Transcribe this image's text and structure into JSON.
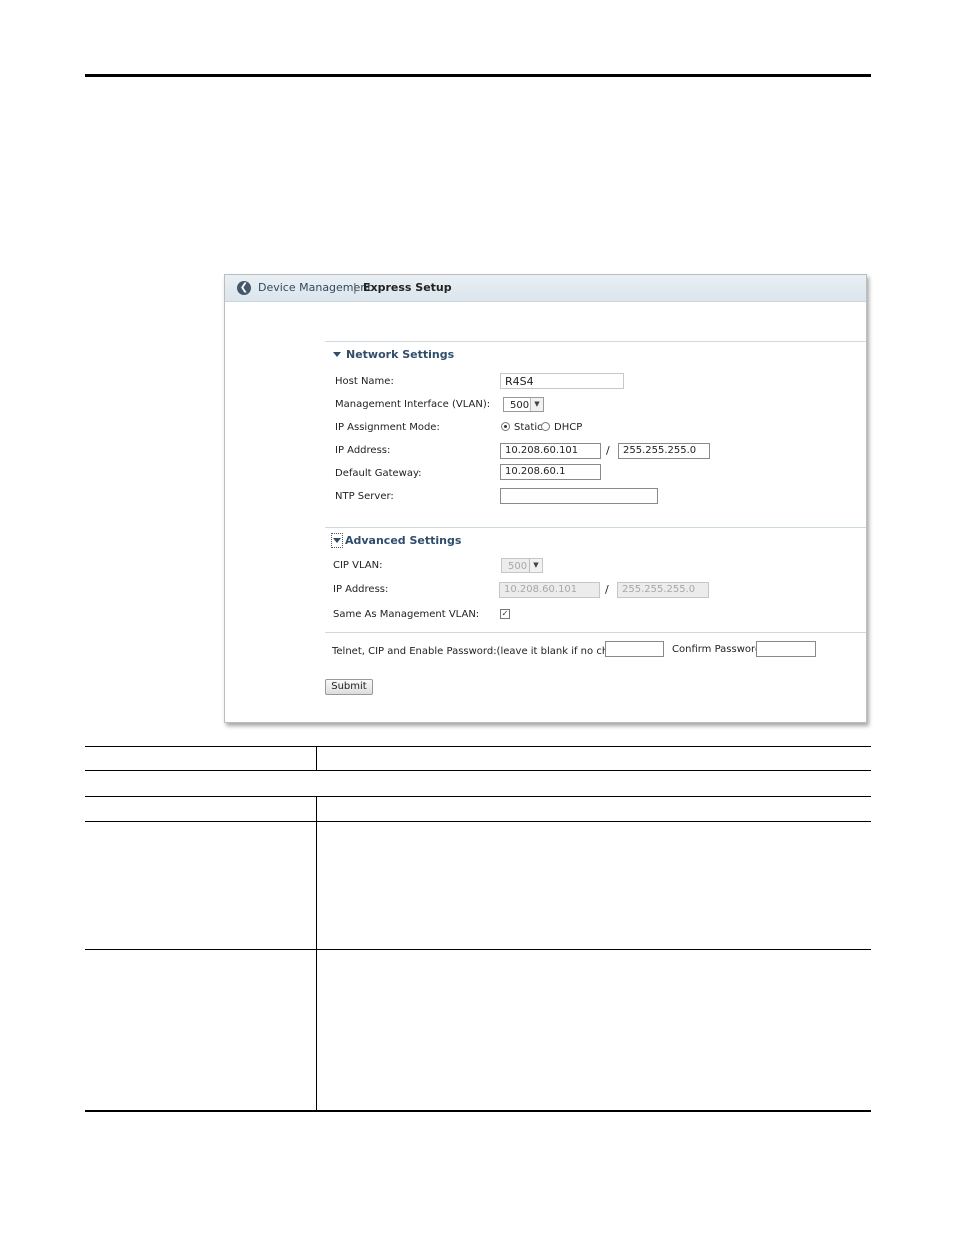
{
  "breadcrumb": {
    "parent": "Device Management",
    "separator": "|",
    "current": "Express Setup"
  },
  "network_settings": {
    "title": "Network Settings",
    "host_name": {
      "label": "Host Name:",
      "value": "R4S4"
    },
    "mgmt_vlan": {
      "label": "Management Interface (VLAN):",
      "value": "500"
    },
    "ip_mode": {
      "label": "IP Assignment Mode:",
      "option_static": "Static",
      "option_dhcp": "DHCP",
      "selected": "Static"
    },
    "ip_address": {
      "label": "IP Address:",
      "ip": "10.208.60.101",
      "separator": "/",
      "mask": "255.255.255.0"
    },
    "gateway": {
      "label": "Default Gateway:",
      "value": "10.208.60.1"
    },
    "ntp": {
      "label": "NTP Server:",
      "value": ""
    }
  },
  "advanced_settings": {
    "title": "Advanced Settings",
    "cip_vlan": {
      "label": "CIP VLAN:",
      "value": "500"
    },
    "ip_address": {
      "label": "IP Address:",
      "ip": "10.208.60.101",
      "separator": "/",
      "mask": "255.255.255.0"
    },
    "same_as_mgmt": {
      "label": "Same As Management VLAN:",
      "checked": true
    }
  },
  "password": {
    "label": "Telnet, CIP and Enable Password:(leave it blank if no change)",
    "confirm_label": "Confirm Password:",
    "value": "",
    "confirm_value": ""
  },
  "submit_label": "Submit",
  "icons": {
    "back": "back-arrow-icon",
    "collapse": "triangle-down-icon",
    "dropdown": "chevron-down-icon",
    "check": "checkmark-icon"
  }
}
